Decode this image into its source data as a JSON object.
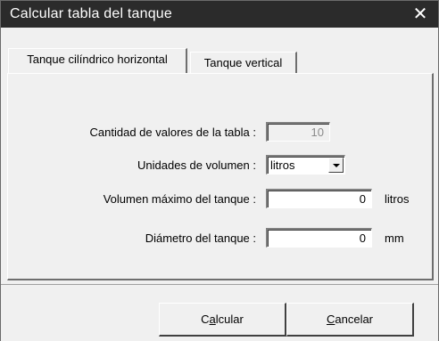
{
  "window": {
    "title": "Calcular tabla del tanque",
    "close_glyph": "✕"
  },
  "tabs": [
    {
      "label": "Tanque cilíndrico horizontal",
      "active": true
    },
    {
      "label": "Tanque vertical",
      "active": false
    }
  ],
  "form": {
    "count_label": "Cantidad de valores de la tabla :",
    "count_value": "10",
    "units_label": "Unidades de volumen :",
    "units_value": "litros",
    "max_volume_label": "Volumen máximo del tanque :",
    "max_volume_value": "0",
    "max_volume_unit": "litros",
    "diameter_label": "Diámetro del tanque :",
    "diameter_value": "0",
    "diameter_unit": "mm"
  },
  "buttons": {
    "calc_pre": "C",
    "calc_mnemonic": "a",
    "calc_post": "lcular",
    "cancel_mnemonic": "C",
    "cancel_post": "ancelar"
  },
  "icons": {
    "close": "close-icon",
    "dropdown": "chevron-down-icon"
  }
}
